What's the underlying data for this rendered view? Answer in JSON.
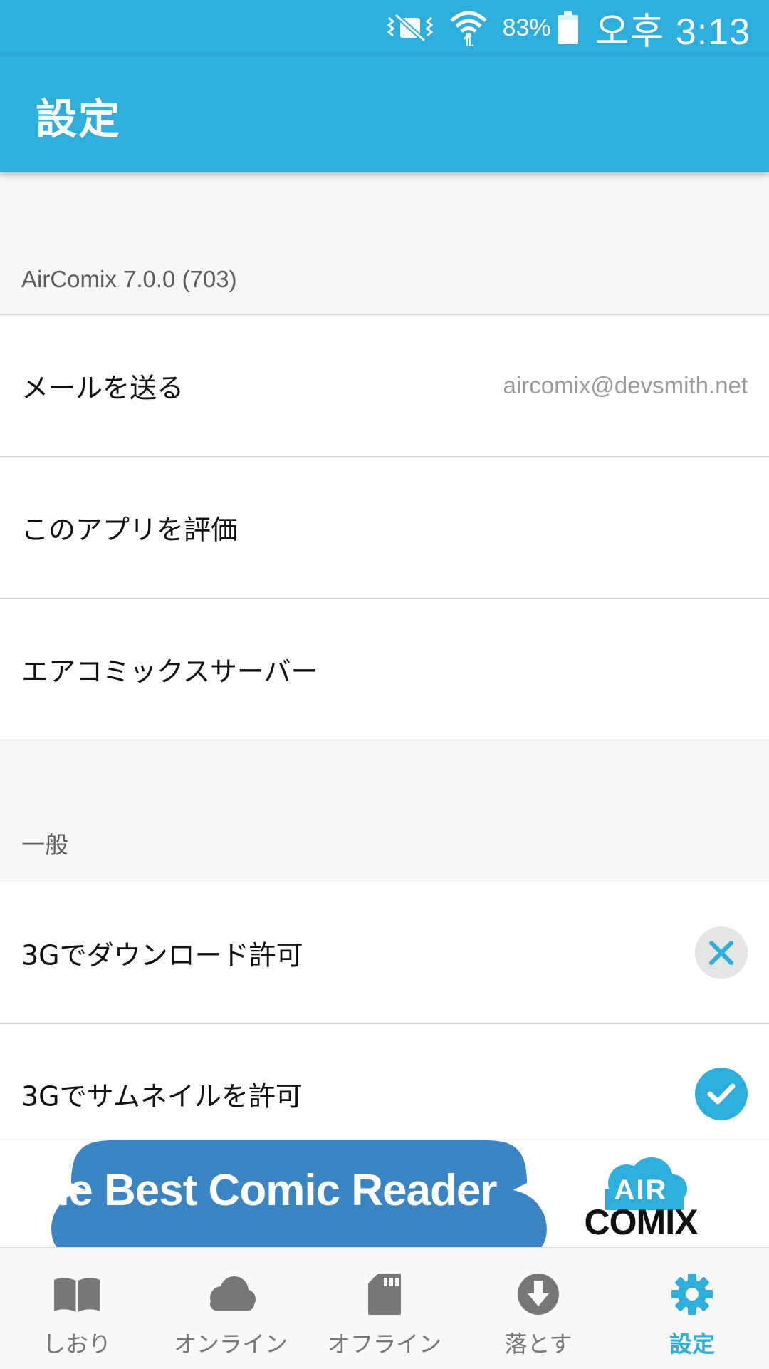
{
  "status_bar": {
    "battery_percent": "83%",
    "time": "오후 3:13",
    "icons": [
      "vibrate-mute-icon",
      "wifi-icon",
      "battery-icon"
    ]
  },
  "app_bar": {
    "title": "設定"
  },
  "sections": [
    {
      "header": "AirComix 7.0.0 (703)",
      "rows": [
        {
          "label": "メールを送る",
          "value": "aircomix@devsmith.net"
        },
        {
          "label": "このアプリを評価"
        },
        {
          "label": "エアコミックスサーバー"
        }
      ]
    },
    {
      "header": "一般",
      "rows": [
        {
          "label": "3Gでダウンロード許可",
          "toggle": false
        },
        {
          "label": "3Gでサムネイルを許可",
          "toggle": true
        }
      ]
    }
  ],
  "banner": {
    "text": "The Best Comic Reader",
    "logo_air": "AIR",
    "logo_comix": "COMIX"
  },
  "bottom_nav": {
    "items": [
      {
        "label": "しおり",
        "icon": "book-icon",
        "active": false
      },
      {
        "label": "オンライン",
        "icon": "cloud-icon",
        "active": false
      },
      {
        "label": "オフライン",
        "icon": "sd-card-icon",
        "active": false
      },
      {
        "label": "落とす",
        "icon": "download-icon",
        "active": false
      },
      {
        "label": "設定",
        "icon": "gear-icon",
        "active": true
      }
    ]
  },
  "colors": {
    "accent": "#2eaedc",
    "banner_cloud": "#3a84c4",
    "toggle_off": "#e4e4e4",
    "nav_inactive": "#777777"
  }
}
